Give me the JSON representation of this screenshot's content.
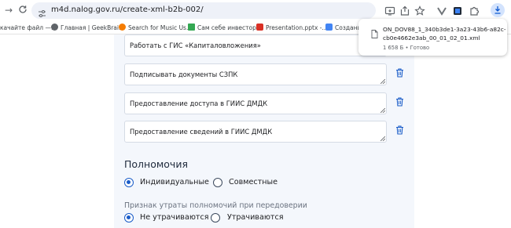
{
  "browser": {
    "url": "m4d.nalog.gov.ru/create-xml-b2b-002/",
    "bookmarks": [
      {
        "label": "качайте файл —...",
        "icon_color": "#9aa0a6"
      },
      {
        "label": "Главная | GeekBrai...",
        "icon_color": "#5f6368"
      },
      {
        "label": "Search for Music Us...",
        "icon_color": "#f57c00"
      },
      {
        "label": "Сам себе инвестор...",
        "icon_color": "#34a853"
      },
      {
        "label": "Presentation.pptx -...",
        "icon_color": "#d93025"
      },
      {
        "label": "Создание",
        "icon_color": "#4285f4"
      }
    ]
  },
  "download": {
    "file_name_line1": "ON_DOV88_1_340b3de1-3a23-43b6-a82c-",
    "file_name_line2": "cb0e4662e3ab_00_01_02_01.xml",
    "status": "1 658 Б • Готово"
  },
  "form": {
    "fields": [
      {
        "text": "Работать с ГИС «Капиталовложения»"
      },
      {
        "text": "Подписывать документы СЗПК"
      },
      {
        "text": "Предоставление доступа в ГИИС ДМДК"
      },
      {
        "text": "Предоставление сведений в ГИИС ДМДК"
      }
    ],
    "powers": {
      "title": "Полномочия",
      "individual": "Индивидуальные",
      "joint": "Совместные",
      "selected": "Индивидуальные"
    },
    "loss": {
      "title": "Признак утраты полномочий при передоверии",
      "not_lost": "Не утрачиваются",
      "lost": "Утрачиваются",
      "selected": "Не утрачиваются"
    }
  },
  "colors": {
    "accent": "#1a5cc8",
    "panel": "#f4f7fc",
    "trash": "#1a5cc8"
  }
}
